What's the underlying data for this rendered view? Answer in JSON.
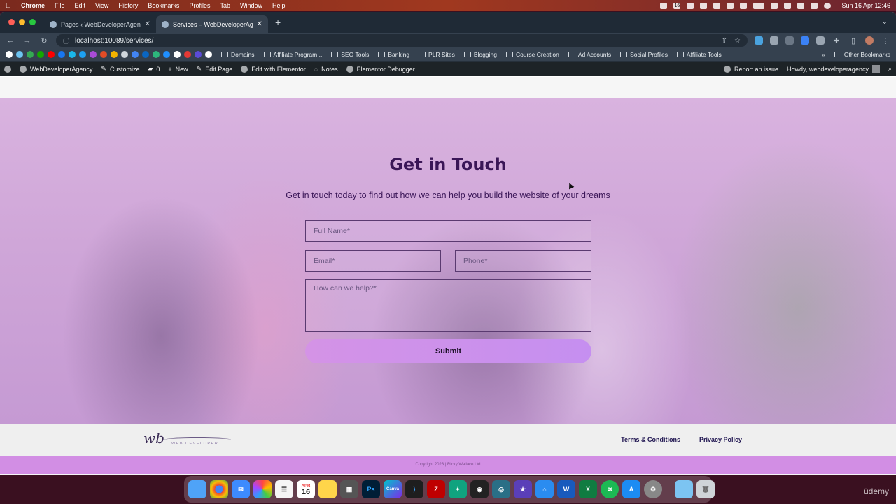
{
  "menubar": {
    "app": "Chrome",
    "items": [
      "File",
      "Edit",
      "View",
      "History",
      "Bookmarks",
      "Profiles",
      "Tab",
      "Window",
      "Help"
    ],
    "date_time": "Sun 16 Apr  12:46",
    "calendar_day": "16"
  },
  "browser": {
    "tabs": [
      {
        "title": "Pages ‹ WebDeveloperAgency",
        "active": false
      },
      {
        "title": "Services – WebDeveloperAgen",
        "active": true
      }
    ],
    "url": "localhost:10089/services/",
    "bookmarks": [
      "Domains",
      "Affiliate Program...",
      "SEO Tools",
      "Banking",
      "PLR Sites",
      "Blogging",
      "Course Creation",
      "Ad Accounts",
      "Social Profiles",
      "Affiliate Tools"
    ],
    "bookmark_overflow": "»",
    "other_bookmarks": "Other Bookmarks",
    "accent_colors": {
      "chrome_frame": "#1f2a36",
      "toolbar": "#35414f"
    }
  },
  "wp_admin_bar": {
    "site_name": "WebDeveloperAgency",
    "customize": "Customize",
    "comments_count": "0",
    "new": "New",
    "edit_page": "Edit Page",
    "edit_elementor": "Edit with Elementor",
    "notes": "Notes",
    "debugger": "Elementor Debugger",
    "report": "Report an issue",
    "howdy": "Howdy, webdeveloperagency"
  },
  "contact": {
    "title": "Get in Touch",
    "subtitle": "Get in touch today to find out how we can help you build the website of your dreams",
    "full_name_placeholder": "Full Name*",
    "email_placeholder": "Email*",
    "phone_placeholder": "Phone*",
    "message_placeholder": "How can we help?*",
    "submit_label": "Submit",
    "colors": {
      "title": "#3a1657",
      "overlay": "#cfa6d8",
      "button": "#d493e6"
    }
  },
  "footer": {
    "logo_mark": "wb",
    "logo_tagline": "WEB DEVELOPER",
    "links": [
      "Terms & Conditions",
      "Privacy Policy"
    ],
    "copyright": "Copyright 2023 | Ricky Wallace Ltd"
  },
  "dock": {
    "apps": [
      "finder",
      "chrome",
      "mail",
      "photos",
      "reminders",
      "calendar",
      "notes",
      "calculator",
      "photoshop",
      "canva",
      "vscode",
      "filezilla",
      "chatgpt",
      "obs",
      "proxyman",
      "imovie",
      "local",
      "word",
      "excel",
      "spotify",
      "app-store",
      "system-settings",
      "folder",
      "trash"
    ],
    "calendar_month": "APR",
    "calendar_day": "16"
  },
  "watermark": "ūdemy"
}
